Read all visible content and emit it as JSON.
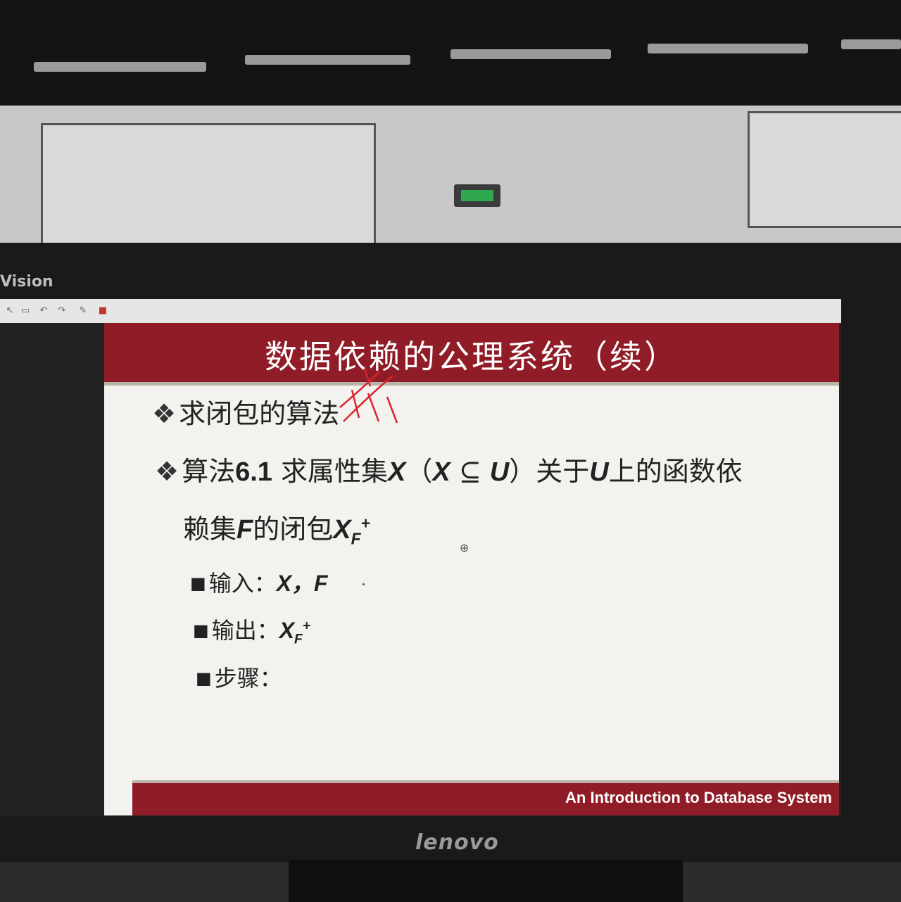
{
  "monitor": {
    "left_brand": "Vision",
    "brand": "lenovo"
  },
  "slide": {
    "title": "数据依赖的公理系统（续）",
    "bullet1": "求闭包的算法",
    "bullet2": {
      "prefix": "算法",
      "number": "6.1",
      "text_a": " 求属性集",
      "var_x": "X",
      "paren_open": "（",
      "var_x2": "X",
      "subset": " ⊆ ",
      "var_u": "U",
      "paren_close": "）",
      "text_b": "关于",
      "var_u2": "U",
      "text_c": "上的函数依",
      "line2_a": "赖集",
      "var_f": "F",
      "line2_b": "的闭包",
      "closure_var": "X",
      "closure_sub": "F",
      "closure_sup": "+"
    },
    "input": {
      "label": "输入：",
      "value": "X，F"
    },
    "output": {
      "label": "输出：",
      "var": "X",
      "sub": "F",
      "sup": "+"
    },
    "steps": {
      "label": "步骤："
    },
    "footer": "An Introduction to Database System"
  },
  "colors": {
    "title_bar": "#8f1c27",
    "slide_bg": "#f3f2ee",
    "annotation": "#d8262d"
  }
}
